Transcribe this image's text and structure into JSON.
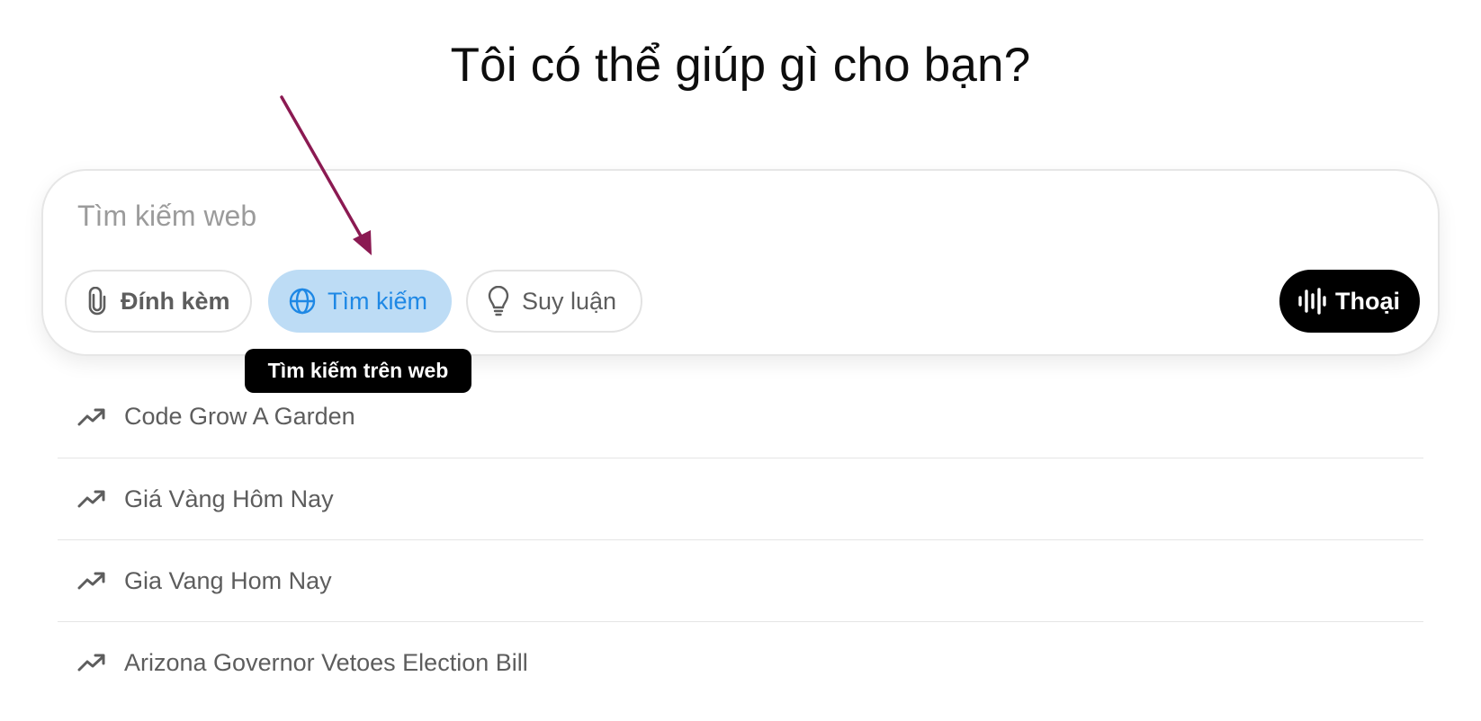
{
  "heading": "Tôi có thể giúp gì cho bạn?",
  "composer": {
    "placeholder": "Tìm kiếm web",
    "attach_label": "Đính kèm",
    "search_label": "Tìm kiếm",
    "reason_label": "Suy luận",
    "voice_label": "Thoại",
    "tooltip": "Tìm kiếm trên web"
  },
  "suggestions": [
    "Code Grow A Garden",
    "Giá Vàng Hôm Nay",
    "Gia Vang Hom Nay",
    "Arizona Governor Vetoes Election Bill"
  ],
  "colors": {
    "search_active_bg": "#bddcf5",
    "search_active_text": "#1e88e5",
    "voice_bg": "#000000",
    "annotation_arrow": "#8b1a52"
  },
  "icons": {
    "attach": "paperclip-icon",
    "search": "globe-icon",
    "reason": "lightbulb-icon",
    "voice": "audio-waveform-icon",
    "suggestion": "trending-up-icon"
  }
}
